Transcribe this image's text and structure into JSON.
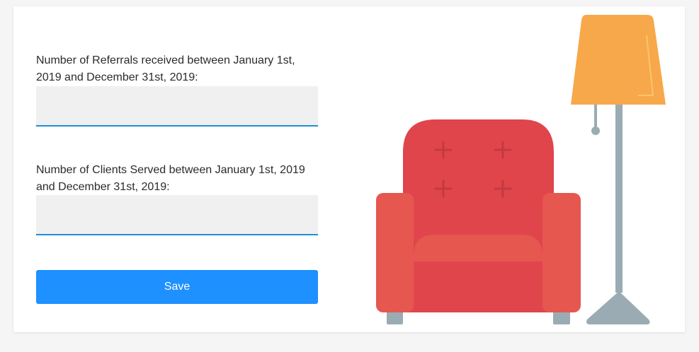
{
  "form": {
    "referrals": {
      "label": "Number of Referrals received between January 1st, 2019 and December 31st, 2019:",
      "value": "",
      "placeholder": ""
    },
    "clients": {
      "label": "Number of Clients Served between January 1st, 2019 and December 31st, 2019:",
      "value": "",
      "placeholder": ""
    },
    "save_label": "Save"
  },
  "colors": {
    "page_background": "#f5f5f5",
    "card_background": "#ffffff",
    "input_background": "#f0f0f0",
    "input_underline": "#1e8fd6",
    "button_primary": "#1e90ff",
    "chair_red": "#e0454c",
    "chair_red_light": "#e5574f",
    "lamp_shade": "#f7a84a",
    "lamp_pole": "#9aabb3"
  },
  "illustration": {
    "name": "armchair-and-floor-lamp"
  }
}
